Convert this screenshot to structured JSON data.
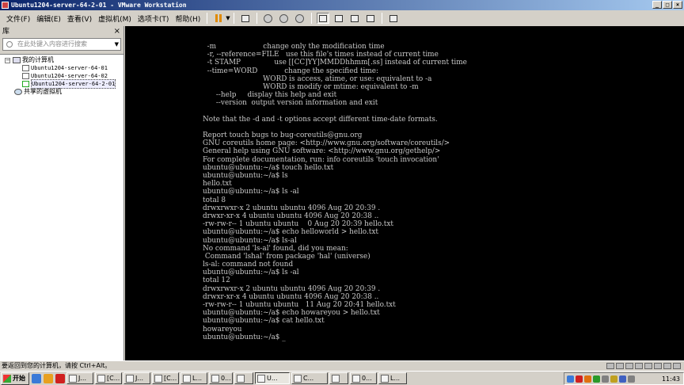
{
  "window": {
    "title": "Ubuntu1204-server-64-2-01 - VMware Workstation"
  },
  "menu": {
    "items": [
      "文件(F)",
      "编辑(E)",
      "查看(V)",
      "虚拟机(M)",
      "选项卡(T)",
      "帮助(H)"
    ]
  },
  "sidebar": {
    "title": "库",
    "search_placeholder": "在此处键入内容进行搜索",
    "tree": {
      "root": "我的计算机",
      "vms": [
        "Ubuntu1204-server-64-01",
        "Ubuntu1204-server-64-02",
        "Ubuntu1204-server-64-2-01"
      ],
      "shared": "共享的虚拟机"
    }
  },
  "terminal": {
    "lines": [
      "  -m                     change only the modification time",
      "  -r, --reference=FILE   use this file's times instead of current time",
      "  -t STAMP               use [[CC]YY]MMDDhhmm[.ss] instead of current time",
      "  --time=WORD            change the specified time:",
      "                           WORD is access, atime, or use: equivalent to -a",
      "                           WORD is modify or mtime: equivalent to -m",
      "      --help     display this help and exit",
      "      --version  output version information and exit",
      "",
      "Note that the -d and -t options accept different time-date formats.",
      "",
      "Report touch bugs to bug-coreutils@gnu.org",
      "GNU coreutils home page: <http://www.gnu.org/software/coreutils/>",
      "General help using GNU software: <http://www.gnu.org/gethelp/>",
      "For complete documentation, run: info coreutils 'touch invocation'",
      "ubuntu@ubuntu:~/a$ touch hello.txt",
      "ubuntu@ubuntu:~/a$ ls",
      "hello.txt",
      "ubuntu@ubuntu:~/a$ ls -al",
      "total 8",
      "drwxrwxr-x 2 ubuntu ubuntu 4096 Aug 20 20:39 .",
      "drwxr-xr-x 4 ubuntu ubuntu 4096 Aug 20 20:38 ..",
      "-rw-rw-r-- 1 ubuntu ubuntu    0 Aug 20 20:39 hello.txt",
      "ubuntu@ubuntu:~/a$ echo helloworld > hello.txt",
      "ubuntu@ubuntu:~/a$ ls-al",
      "No command 'ls-al' found, did you mean:",
      " Command 'lshal' from package 'hal' (universe)",
      "ls-al: command not found",
      "ubuntu@ubuntu:~/a$ ls -al",
      "total 12",
      "drwxrwxr-x 2 ubuntu ubuntu 4096 Aug 20 20:39 .",
      "drwxr-xr-x 4 ubuntu ubuntu 4096 Aug 20 20:38 ..",
      "-rw-rw-r-- 1 ubuntu ubuntu   11 Aug 20 20:41 hello.txt",
      "ubuntu@ubuntu:~/a$ echo howareyou > hello.txt",
      "ubuntu@ubuntu:~/a$ cat hello.txt",
      "howareyou",
      "ubuntu@ubuntu:~/a$ _"
    ]
  },
  "statusbar": {
    "text": "要返回到您的计算机，请按 Ctrl+Alt。"
  },
  "taskbar": {
    "start": "开始",
    "buttons": [
      "J...",
      "[C...",
      "J...",
      "[C...",
      "L...",
      "0...",
      "",
      "U...",
      "C...",
      "",
      "0...",
      "L..."
    ],
    "active_index": 7,
    "clock": "11:43"
  },
  "colors": {
    "title_bar_start": "#0a246a",
    "title_bar_end": "#a6caf0",
    "console_bg": "#000000",
    "console_fg": "#c9c9c9"
  }
}
